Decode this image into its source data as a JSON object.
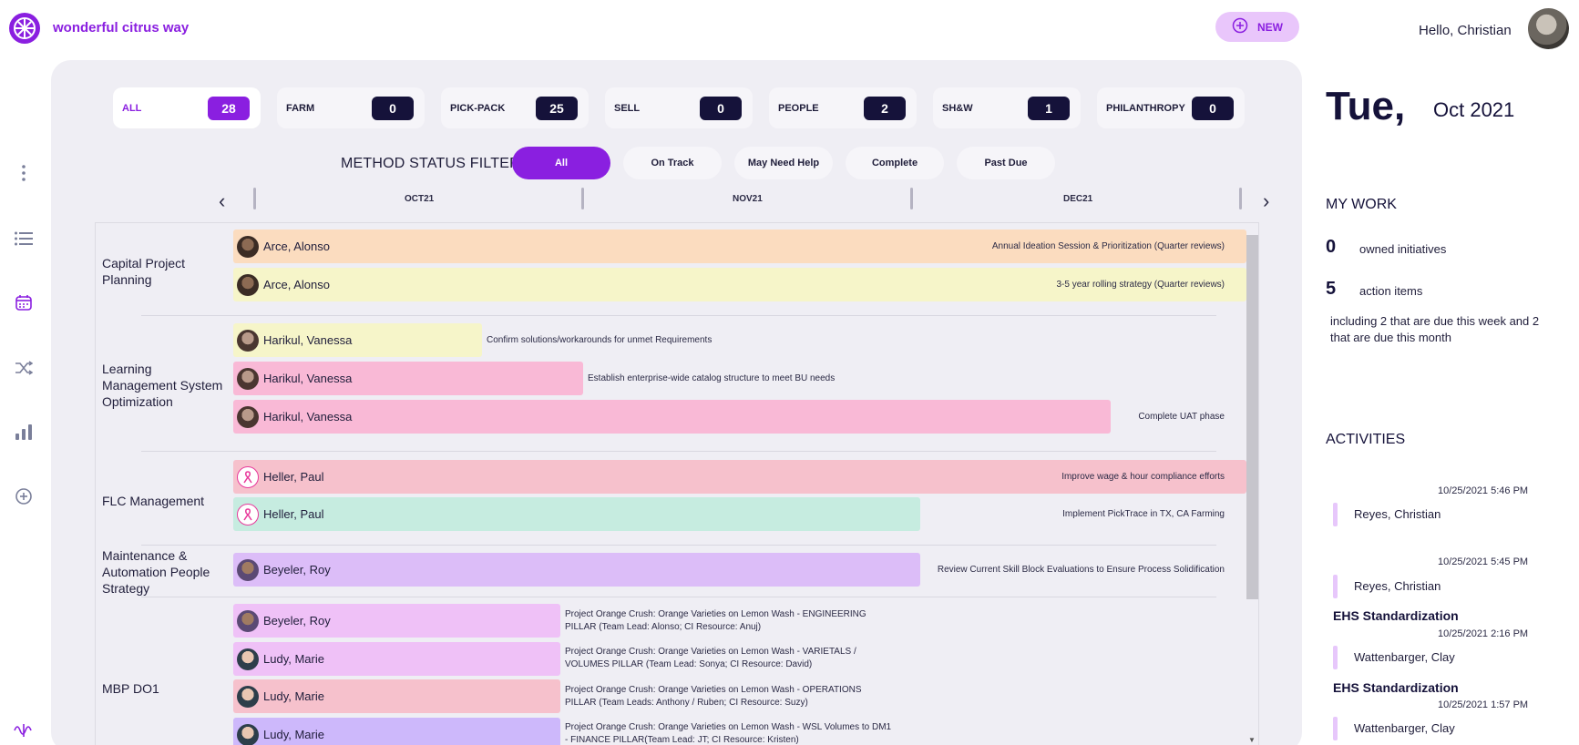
{
  "brand": {
    "name": "wonderful citrus way"
  },
  "header": {
    "new_label": "NEW",
    "greeting": "Hello, Christian"
  },
  "categories": [
    {
      "label": "ALL",
      "count": "28"
    },
    {
      "label": "FARM",
      "count": "0"
    },
    {
      "label": "PICK-PACK",
      "count": "25"
    },
    {
      "label": "SELL",
      "count": "0"
    },
    {
      "label": "PEOPLE",
      "count": "2"
    },
    {
      "label": "SH&W",
      "count": "1"
    },
    {
      "label": "PHILANTHROPY",
      "count": "0"
    }
  ],
  "filter": {
    "title": "METHOD STATUS FILTER",
    "options": [
      "All",
      "On Track",
      "May Need Help",
      "Complete",
      "Past Due"
    ],
    "selected": "All"
  },
  "months": [
    "OCT21",
    "NOV21",
    "DEC21"
  ],
  "groups": [
    {
      "label": "Capital Project Planning"
    },
    {
      "label": "Learning Management System Optimization"
    },
    {
      "label": "FLC Management"
    },
    {
      "label": "Maintenance & Automation People Strategy"
    },
    {
      "label": "MBP DO1"
    }
  ],
  "items": [
    {
      "owner": "Arce, Alonso",
      "desc": "Annual Ideation Session & Prioritization (Quarter reviews)",
      "color": "#fbdcbf"
    },
    {
      "owner": "Arce, Alonso",
      "desc": "3-5 year rolling strategy (Quarter reviews)",
      "color": "#f6f5c9"
    },
    {
      "owner": "Harikul, Vanessa",
      "desc": "Confirm solutions/workarounds for unmet Requirements",
      "color": "#f6f5c9"
    },
    {
      "owner": "Harikul, Vanessa",
      "desc": "Establish enterprise-wide catalog structure to meet BU needs",
      "color": "#f9b9d6"
    },
    {
      "owner": "Harikul, Vanessa",
      "desc": "Complete UAT phase",
      "color": "#f9b9d6"
    },
    {
      "owner": "Heller, Paul",
      "desc": "Improve wage & hour compliance efforts",
      "color": "#f6c1cc"
    },
    {
      "owner": "Heller, Paul",
      "desc": "Implement PickTrace in TX, CA Farming",
      "color": "#c6ece0"
    },
    {
      "owner": "Beyeler, Roy",
      "desc": "Review Current Skill Block Evaluations to Ensure Process Solidification",
      "color": "#dcbdf8"
    },
    {
      "owner": "Beyeler, Roy",
      "desc": "Project Orange Crush: Orange Varieties on Lemon Wash - ENGINEERING PILLAR (Team Lead: Alonso; CI Resource: Anuj)",
      "color": "#efc1f7"
    },
    {
      "owner": "Ludy, Marie",
      "desc": "Project Orange Crush: Orange Varieties on Lemon Wash - VARIETALS / VOLUMES PILLAR (Team Lead: Sonya; CI Resource: David)",
      "color": "#efc1f7"
    },
    {
      "owner": "Ludy, Marie",
      "desc": "Project Orange Crush: Orange Varieties on Lemon Wash - OPERATIONS PILLAR (Team Leads: Anthony / Ruben; CI Resource: Suzy)",
      "color": "#f6c1cc"
    },
    {
      "owner": "Ludy, Marie",
      "desc": "Project Orange Crush: Orange Varieties on Lemon Wash - WSL Volumes to DM1 - FINANCE PILLAR(Team Lead: JT; CI Resource: Kristen)",
      "color": "#cdb8fb"
    }
  ],
  "right": {
    "day": "Tue,",
    "month": "Oct 2021",
    "my_work_title": "MY WORK",
    "owned_count": "0",
    "owned_label": "owned initiatives",
    "action_count": "5",
    "action_label": "action items",
    "due_note": "including 2 that are due this week and 2 that are due this month",
    "activities_title": "ACTIVITIES",
    "activities": [
      {
        "time": "10/25/2021 5:46 PM",
        "name": "Reyes, Christian",
        "title": ""
      },
      {
        "time": "10/25/2021 5:45 PM",
        "name": "Reyes, Christian",
        "title": "EHS Standardization"
      },
      {
        "time": "10/25/2021 2:16 PM",
        "name": "Wattenbarger, Clay",
        "title": "EHS Standardization"
      },
      {
        "time": "10/25/2021 1:57 PM",
        "name": "Wattenbarger, Clay",
        "title": ""
      }
    ]
  },
  "icons": {
    "logo": "asterisk-logo-icon",
    "new": "plus-circle-icon",
    "nav": [
      "more-vertical-icon",
      "list-icon",
      "calendar-icon",
      "shuffle-icon",
      "bar-chart-icon",
      "plus-circle-icon",
      "wave-logo-icon"
    ]
  }
}
